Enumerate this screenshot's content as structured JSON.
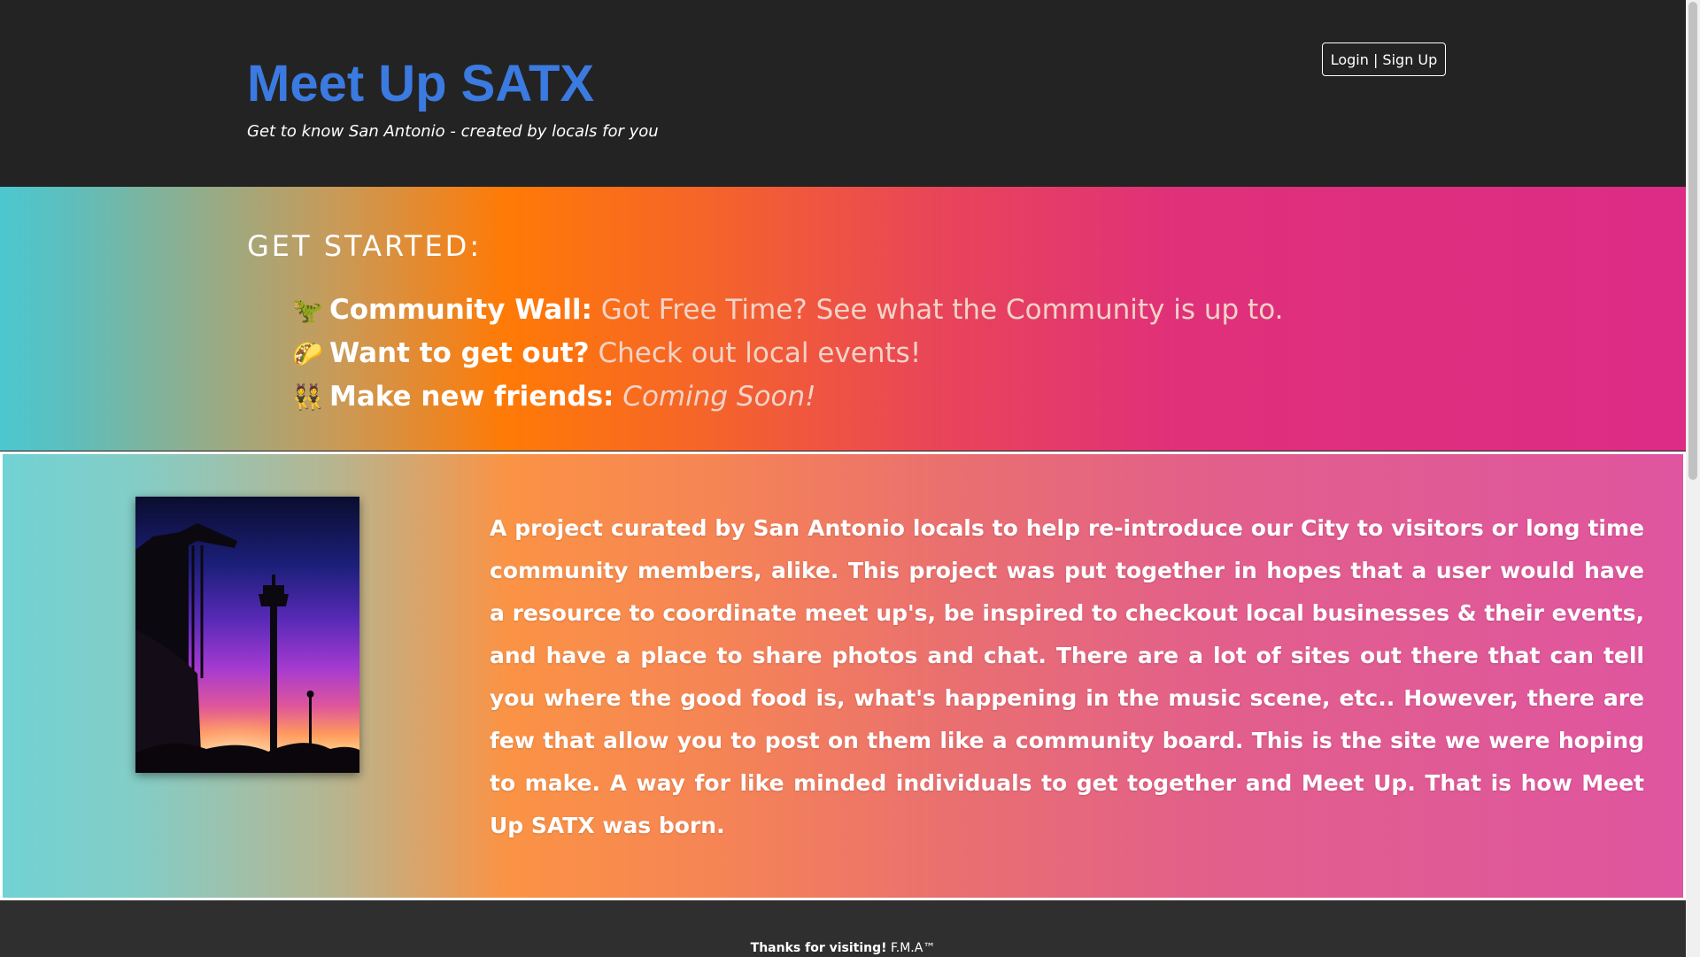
{
  "header": {
    "title": "Meet Up SATX",
    "tagline": "Get to know San Antonio - created by locals for you",
    "login_label": "Login | Sign Up",
    "title_color": "#3b7ae0"
  },
  "get_started": {
    "heading": "GET STARTED:",
    "items": [
      {
        "icon": "🦖",
        "icon_name": "dinosaur-icon",
        "label": "Community Wall:",
        "link": "Got Free Time? See what the Community is up to."
      },
      {
        "icon": "🌮",
        "icon_name": "taco-icon",
        "label": "Want to get out?",
        "link": "Check out local events!"
      },
      {
        "icon": "👯",
        "icon_name": "friends-icon",
        "label": "Make new friends:",
        "link": "Coming Soon!"
      }
    ]
  },
  "about": {
    "photo_subject": "San Antonio Tower of the Americas silhouette at sunset",
    "text": "A project curated by San Antonio locals to help re-introduce our City to visitors or long time community members, alike. This project was put together in hopes that a user would have a resource to coordinate meet up's, be inspired to checkout local businesses & their events, and have a place to share photos and chat. There are a lot of sites out there that can tell you where the good food is, what's happening in the music scene, etc.. However, there are few that allow you to post on them like a community board. This is the site we were hoping to make. A way for like minded individuals to get together and Meet Up. That is how Meet Up SATX was born."
  },
  "footer": {
    "thanks": "Thanks for visiting!",
    "credit": " F.M.A™"
  }
}
